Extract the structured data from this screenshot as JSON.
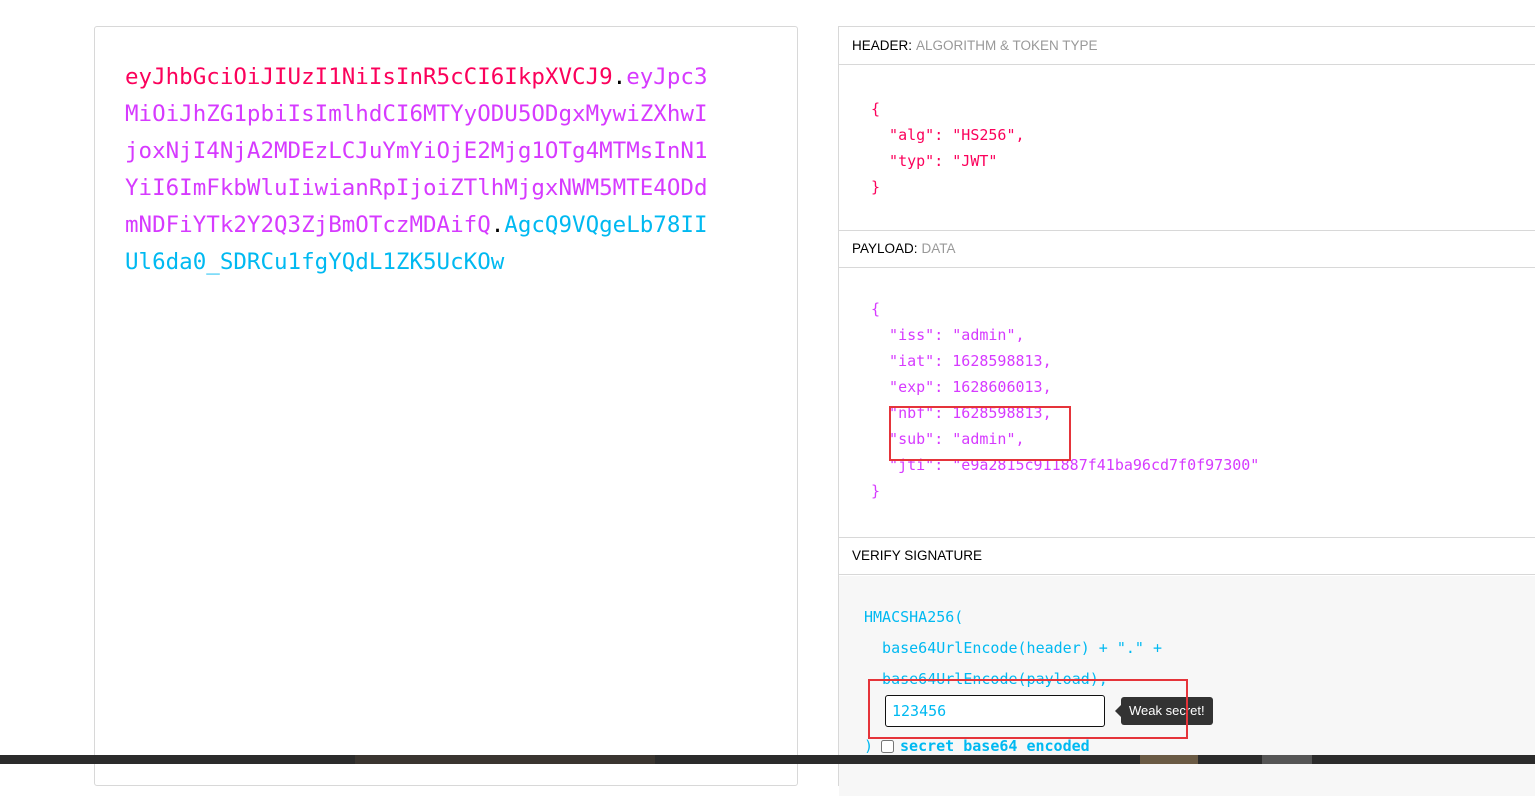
{
  "encoded": {
    "header_part": "eyJhbGciOiJIUzI1NiIsInR5cCI6IkpXVCJ9",
    "payload_part": "eyJpc3MiOiJhZG1pbiIsImlhdCI6MTYyODU5ODgxMywiZXhwIjoxNjI4NjA2MDEzLCJuYmYiOjE2Mjg1OTg4MTMsInN1YiI6ImFkbWluIiwianRpIjoiZTlhMjgxNWM5MTE4ODdmNDFiYTk2Y2Q3ZjBmOTczMDAifQ",
    "signature_part": "AgcQ9VQgeLb78IIUl6da0_SDRCu1fgYQdL1ZK5UcKOw",
    "dot": "."
  },
  "header_section": {
    "title": "HEADER:",
    "subtitle": "ALGORITHM & TOKEN TYPE",
    "json": "{\n  \"alg\": \"HS256\",\n  \"typ\": \"JWT\"\n}"
  },
  "payload_section": {
    "title": "PAYLOAD:",
    "subtitle": "DATA",
    "json": "{\n  \"iss\": \"admin\",\n  \"iat\": 1628598813,\n  \"exp\": 1628606013,\n  \"nbf\": 1628598813,\n  \"sub\": \"admin\",\n  \"jti\": \"e9a2815c911887f41ba96cd7f0f97300\"\n}"
  },
  "verify_section": {
    "title": "VERIFY SIGNATURE",
    "line1": "HMACSHA256(",
    "line2": "  base64UrlEncode(header) + \".\" +",
    "line3": "  base64UrlEncode(payload),",
    "secret_value": "123456",
    "tooltip": "Weak secret!",
    "close_paren": ")",
    "b64_label": "secret base64 encoded"
  },
  "colors": {
    "header": "#fb015b",
    "payload": "#d63aff",
    "signature": "#00b9f1",
    "highlight": "#e5343a"
  }
}
